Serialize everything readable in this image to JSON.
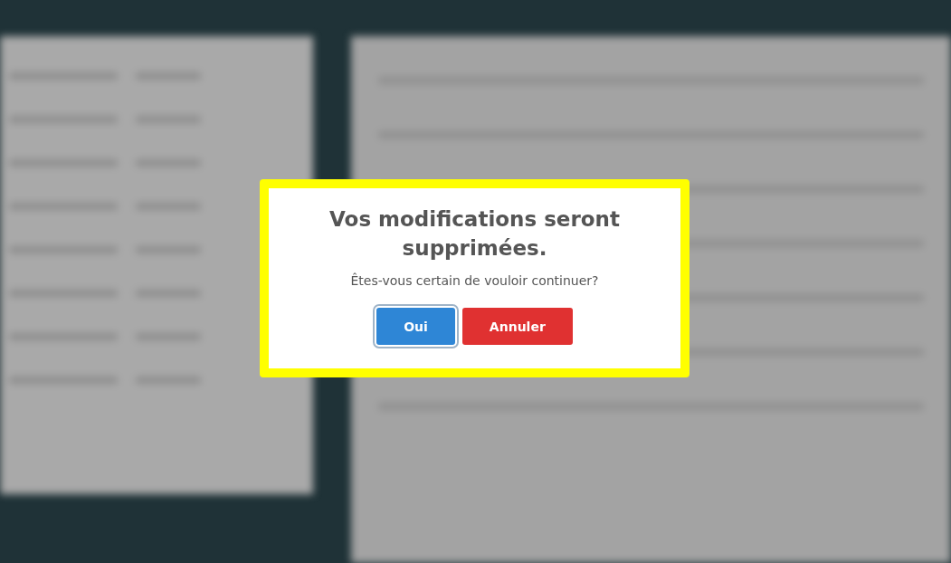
{
  "dialog": {
    "title": "Vos modifications seront supprimées.",
    "message": "Êtes-vous certain de vouloir continuer?",
    "buttons": [
      {
        "label": "Oui",
        "kind": "confirm",
        "focused": true
      },
      {
        "label": "Annuler",
        "kind": "cancel",
        "focused": false
      }
    ]
  }
}
